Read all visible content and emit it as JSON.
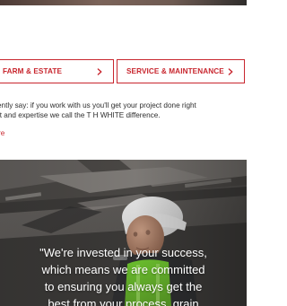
{
  "services": {
    "left_button_label": "FARM & ESTATE",
    "right_button_label": "SERVICE & MAINTENANCE"
  },
  "intro": {
    "line1": "ently say: if you work with us you'll get your project done right",
    "line2": "rt and expertise we call the T H WHITE difference.",
    "read_more": "re"
  },
  "hero": {
    "quote_line1": "\"We're invested in your success,",
    "quote_line2": "which means we are committed",
    "quote_line3": "to ensuring you always get the",
    "quote_line4": "best from your process, grain"
  },
  "colors": {
    "accent": "#c8262e",
    "text": "#2d2d2d"
  },
  "icons": {
    "button_chevron": "chevron-right-icon"
  }
}
